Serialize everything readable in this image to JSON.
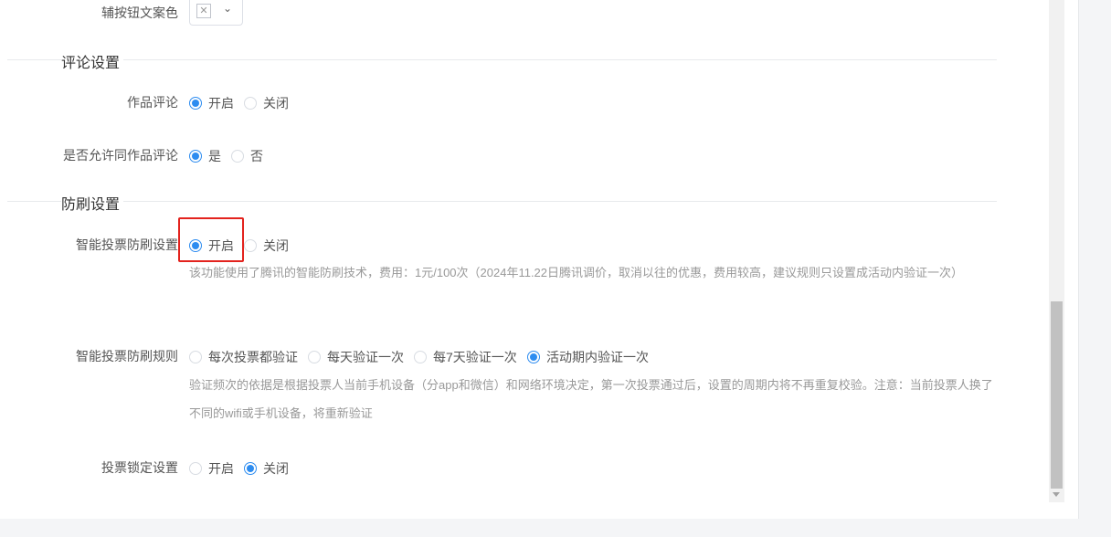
{
  "top": {
    "secondary_button_color_label": "辅按钮文案色"
  },
  "comment": {
    "section_title": "评论设置",
    "work_comment": {
      "label": "作品评论",
      "options": [
        "开启",
        "关闭"
      ],
      "selected": "开启"
    },
    "allow_comment": {
      "label": "是否允许同作品评论",
      "options": [
        "是",
        "否"
      ],
      "selected": "是"
    }
  },
  "anti_fraud": {
    "section_title": "防刷设置",
    "smart_vote": {
      "label": "智能投票防刷设置",
      "options": [
        "开启",
        "关闭"
      ],
      "selected": "开启",
      "help": "该功能使用了腾讯的智能防刷技术，费用：1元/100次（2024年11.22日腾讯调价，取消以往的优惠，费用较高，建议规则只设置成活动内验证一次）"
    },
    "smart_rule": {
      "label": "智能投票防刷规则",
      "options": [
        "每次投票都验证",
        "每天验证一次",
        "每7天验证一次",
        "活动期内验证一次"
      ],
      "selected": "活动期内验证一次",
      "help": "验证频次的依据是根据投票人当前手机设备（分app和微信）和网络环境决定，第一次投票通过后，设置的周期内将不再重复校验。注意：当前投票人换了不同的wifi或手机设备，将重新验证"
    },
    "vote_lock": {
      "label": "投票锁定设置",
      "options": [
        "开启",
        "关闭"
      ],
      "selected": "关闭"
    }
  },
  "colors": {
    "accent": "#2d8cf0",
    "highlight": "#e3231e"
  }
}
